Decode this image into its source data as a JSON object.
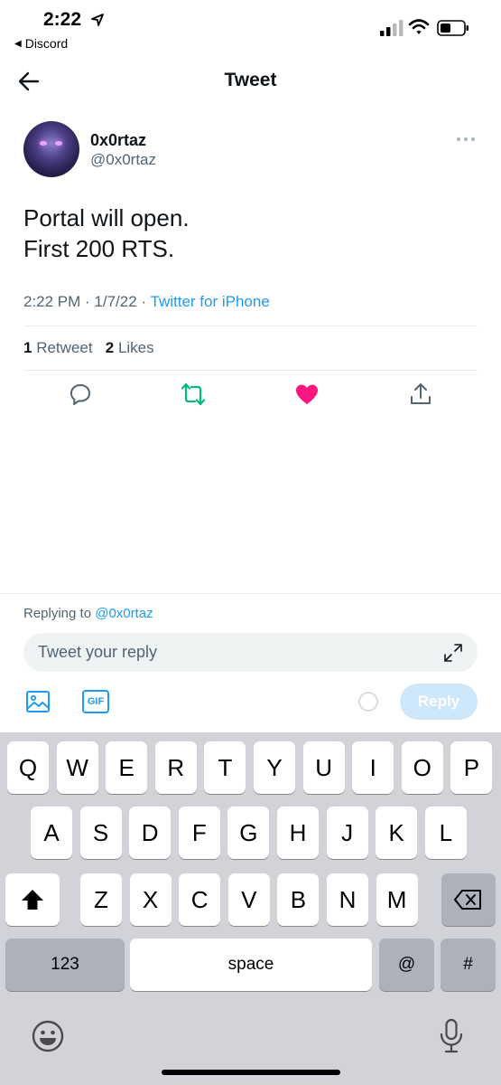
{
  "status_bar": {
    "time": "2:22",
    "back_app": "Discord"
  },
  "header": {
    "title": "Tweet"
  },
  "tweet": {
    "display_name": "0x0rtaz",
    "handle": "@0x0rtaz",
    "text_line1": "Portal will open.",
    "text_line2": "First 200 RTS.",
    "time": "2:22 PM",
    "separator1": " · ",
    "date": "1/7/22",
    "separator2": " · ",
    "source": "Twitter for iPhone",
    "retweet_count": "1",
    "retweet_label": "Retweet",
    "like_count": "2",
    "like_label": "Likes",
    "liked": true
  },
  "composer": {
    "replying_prefix": "Replying to",
    "replying_to": "@0x0rtaz",
    "placeholder": "Tweet your reply",
    "gif_label": "GIF",
    "reply_button": "Reply"
  },
  "keyboard": {
    "row1": [
      "Q",
      "W",
      "E",
      "R",
      "T",
      "Y",
      "U",
      "I",
      "O",
      "P"
    ],
    "row2": [
      "A",
      "S",
      "D",
      "F",
      "G",
      "H",
      "J",
      "K",
      "L"
    ],
    "row3": [
      "Z",
      "X",
      "C",
      "V",
      "B",
      "N",
      "M"
    ],
    "numbers_key": "123",
    "space_key": "space",
    "at_key": "@",
    "hash_key": "#"
  },
  "colors": {
    "accent": "#1d9bf0",
    "retweet": "#00ba7c",
    "like": "#f91880",
    "secondary_text": "#536471"
  }
}
